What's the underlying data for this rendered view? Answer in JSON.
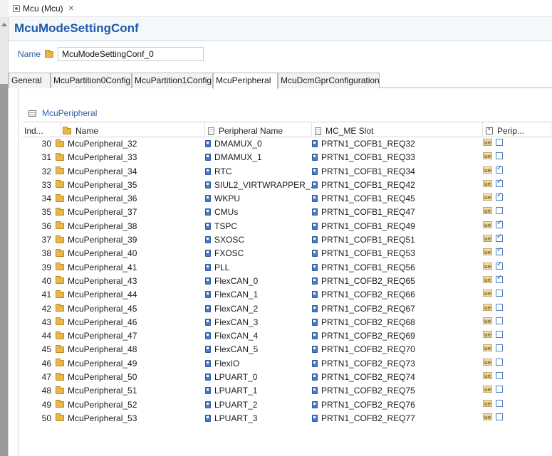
{
  "editor_tab": {
    "title": "Mcu (Mcu)",
    "close": "✕"
  },
  "header": {
    "title": "McuModeSettingConf"
  },
  "name_field": {
    "label": "Name",
    "value": "McuModeSettingConf_0"
  },
  "tabs": [
    "General",
    "McuPartition0Config",
    "McuPartition1Config",
    "McuPeripheral",
    "McuDcmGprConfiguration"
  ],
  "active_tab": "McuPeripheral",
  "section": {
    "title": "McuPeripheral"
  },
  "table": {
    "columns": [
      "Ind...",
      "Name",
      "Peripheral Name",
      "MC_ME Slot",
      "Perip..."
    ],
    "rows": [
      {
        "index": "30",
        "name": "McuPeripheral_32",
        "peripheral": "DMAMUX_0",
        "slot": "PRTN1_COFB1_REQ32",
        "enabled": false
      },
      {
        "index": "31",
        "name": "McuPeripheral_33",
        "peripheral": "DMAMUX_1",
        "slot": "PRTN1_COFB1_REQ33",
        "enabled": false
      },
      {
        "index": "32",
        "name": "McuPeripheral_34",
        "peripheral": "RTC",
        "slot": "PRTN1_COFB1_REQ34",
        "enabled": true
      },
      {
        "index": "33",
        "name": "McuPeripheral_35",
        "peripheral": "SIUL2_VIRTWRAPPER_...",
        "slot": "PRTN1_COFB1_REQ42",
        "enabled": true
      },
      {
        "index": "34",
        "name": "McuPeripheral_36",
        "peripheral": "WKPU",
        "slot": "PRTN1_COFB1_REQ45",
        "enabled": true
      },
      {
        "index": "35",
        "name": "McuPeripheral_37",
        "peripheral": "CMUs",
        "slot": "PRTN1_COFB1_REQ47",
        "enabled": false
      },
      {
        "index": "36",
        "name": "McuPeripheral_38",
        "peripheral": "TSPC",
        "slot": "PRTN1_COFB1_REQ49",
        "enabled": true
      },
      {
        "index": "37",
        "name": "McuPeripheral_39",
        "peripheral": "SXOSC",
        "slot": "PRTN1_COFB1_REQ51",
        "enabled": true
      },
      {
        "index": "38",
        "name": "McuPeripheral_40",
        "peripheral": "FXOSC",
        "slot": "PRTN1_COFB1_REQ53",
        "enabled": true
      },
      {
        "index": "39",
        "name": "McuPeripheral_41",
        "peripheral": "PLL",
        "slot": "PRTN1_COFB1_REQ56",
        "enabled": true
      },
      {
        "index": "40",
        "name": "McuPeripheral_43",
        "peripheral": "FlexCAN_0",
        "slot": "PRTN1_COFB2_REQ65",
        "enabled": true
      },
      {
        "index": "41",
        "name": "McuPeripheral_44",
        "peripheral": "FlexCAN_1",
        "slot": "PRTN1_COFB2_REQ66",
        "enabled": false
      },
      {
        "index": "42",
        "name": "McuPeripheral_45",
        "peripheral": "FlexCAN_2",
        "slot": "PRTN1_COFB2_REQ67",
        "enabled": false
      },
      {
        "index": "43",
        "name": "McuPeripheral_46",
        "peripheral": "FlexCAN_3",
        "slot": "PRTN1_COFB2_REQ68",
        "enabled": false
      },
      {
        "index": "44",
        "name": "McuPeripheral_47",
        "peripheral": "FlexCAN_4",
        "slot": "PRTN1_COFB2_REQ69",
        "enabled": false
      },
      {
        "index": "45",
        "name": "McuPeripheral_48",
        "peripheral": "FlexCAN_5",
        "slot": "PRTN1_COFB2_REQ70",
        "enabled": false
      },
      {
        "index": "46",
        "name": "McuPeripheral_49",
        "peripheral": "FlexIO",
        "slot": "PRTN1_COFB2_REQ73",
        "enabled": false
      },
      {
        "index": "47",
        "name": "McuPeripheral_50",
        "peripheral": "LPUART_0",
        "slot": "PRTN1_COFB2_REQ74",
        "enabled": false
      },
      {
        "index": "48",
        "name": "McuPeripheral_51",
        "peripheral": "LPUART_1",
        "slot": "PRTN1_COFB2_REQ75",
        "enabled": false
      },
      {
        "index": "49",
        "name": "McuPeripheral_52",
        "peripheral": "LPUART_2",
        "slot": "PRTN1_COFB2_REQ76",
        "enabled": false
      },
      {
        "index": "50",
        "name": "McuPeripheral_53",
        "peripheral": "LPUART_3",
        "slot": "PRTN1_COFB2_REQ77",
        "enabled": false
      }
    ]
  },
  "colors": {
    "title_blue": "#1f5aa6",
    "link_blue": "#2e5fa3",
    "folder": "#e9b84a"
  }
}
